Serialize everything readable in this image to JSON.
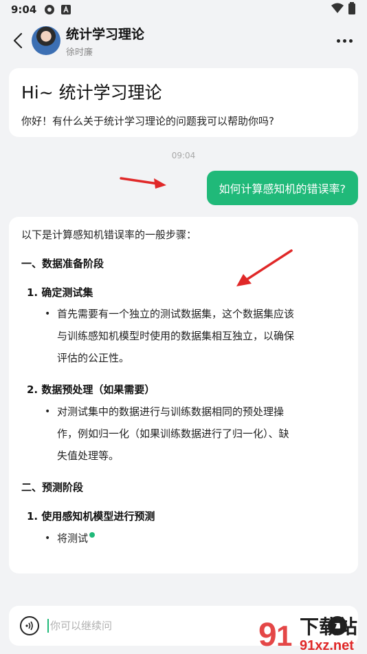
{
  "status_bar": {
    "time": "9:04",
    "icons": [
      "settings-icon",
      "a-badge-icon"
    ],
    "right_icons": [
      "wifi-icon",
      "battery-icon"
    ]
  },
  "header": {
    "title": "统计学习理论",
    "subtitle": "徐时廉",
    "back_icon": "chevron-left-icon",
    "more_icon": "more-horizontal-icon"
  },
  "intro": {
    "title": "Hi~ 统计学习理论",
    "text": "你好！有什么关于统计学习理论的问题我可以帮助你吗?"
  },
  "timestamp": "09:04",
  "user_message": "如何计算感知机的错误率?",
  "answer": {
    "intro": "以下是计算感知机错误率的一般步骤：",
    "sections": [
      {
        "title": "一、数据准备阶段",
        "steps": [
          {
            "title": "1. 确定测试集",
            "bullets": [
              "首先需要有一个独立的测试数据集，这个数据集应该",
              "与训练感知机模型时使用的数据集相互独立，以确保",
              "评估的公正性。"
            ]
          },
          {
            "title": "2. 数据预处理（如果需要）",
            "bullets": [
              "对测试集中的数据进行与训练数据相同的预处理操",
              "作，例如归一化（如果训练数据进行了归一化）、缺",
              "失值处理等。"
            ]
          }
        ]
      },
      {
        "title": "二、预测阶段",
        "steps": [
          {
            "title": "1. 使用感知机模型进行预测",
            "bullets": [
              "将测试"
            ]
          }
        ]
      }
    ]
  },
  "input": {
    "placeholder": "你可以继续问"
  },
  "watermark": {
    "brand": "下载站",
    "domain": "91xz.net"
  },
  "colors": {
    "accent": "#20b979",
    "arrow": "#e02828",
    "background": "#f2f3f5"
  }
}
